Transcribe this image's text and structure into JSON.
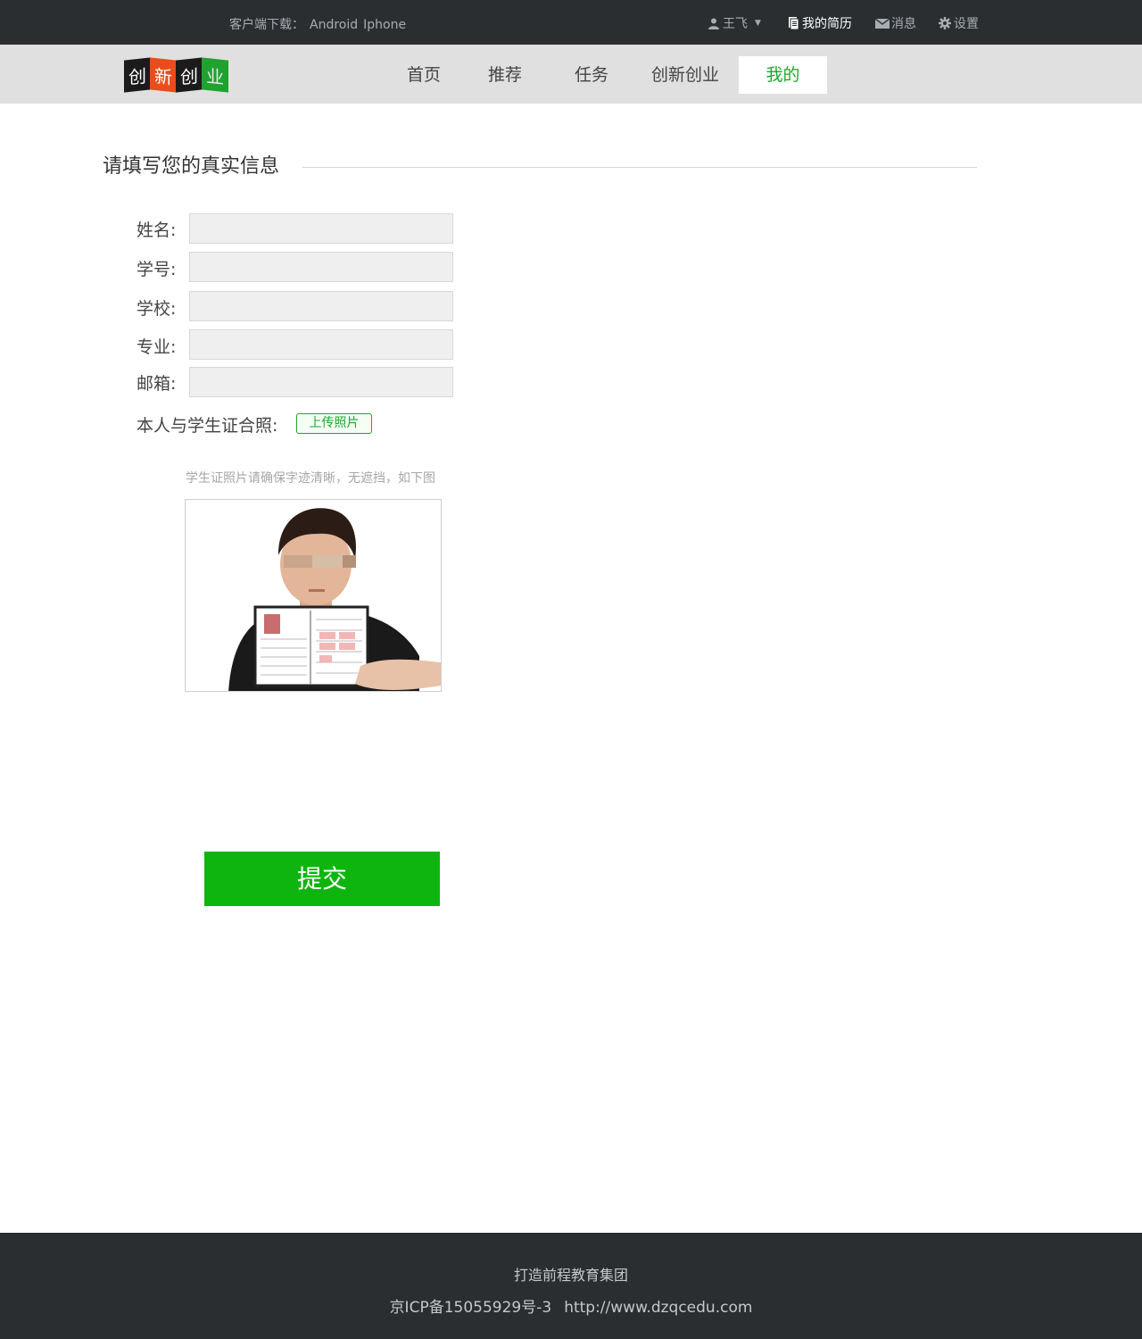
{
  "topbar": {
    "download_label": "客户端下载：",
    "android": "Android",
    "iphone": "Iphone",
    "user_name": "王飞",
    "resume": "我的简历",
    "messages": "消息",
    "settings": "设置"
  },
  "nav": {
    "logo_chars": [
      "创",
      "新",
      "创",
      "业"
    ],
    "items": [
      {
        "label": "首页"
      },
      {
        "label": "推荐"
      },
      {
        "label": "任务"
      },
      {
        "label": "创新创业"
      },
      {
        "label": "我的"
      }
    ],
    "active_index": 4
  },
  "form": {
    "title": "请填写您的真实信息",
    "fields": [
      {
        "label": "姓名:",
        "value": ""
      },
      {
        "label": "学号:",
        "value": ""
      },
      {
        "label": "学校:",
        "value": ""
      },
      {
        "label": "专业:",
        "value": ""
      },
      {
        "label": "邮箱:",
        "value": ""
      }
    ],
    "photo_label": "本人与学生证合照:",
    "upload_button": "上传照片",
    "hint": "学生证照片请确保字迹清晰，无遮挡，如下图",
    "submit": "提交"
  },
  "footer": {
    "line1": "打造前程教育集团",
    "icp": "京ICP备15055929号-3",
    "url": "http://www.dzqcedu.com"
  },
  "colors": {
    "accent": "#1aa82d",
    "submit": "#0fb50f",
    "dark_bar": "#2a2e31",
    "nav_bg": "#e0e0e0"
  }
}
